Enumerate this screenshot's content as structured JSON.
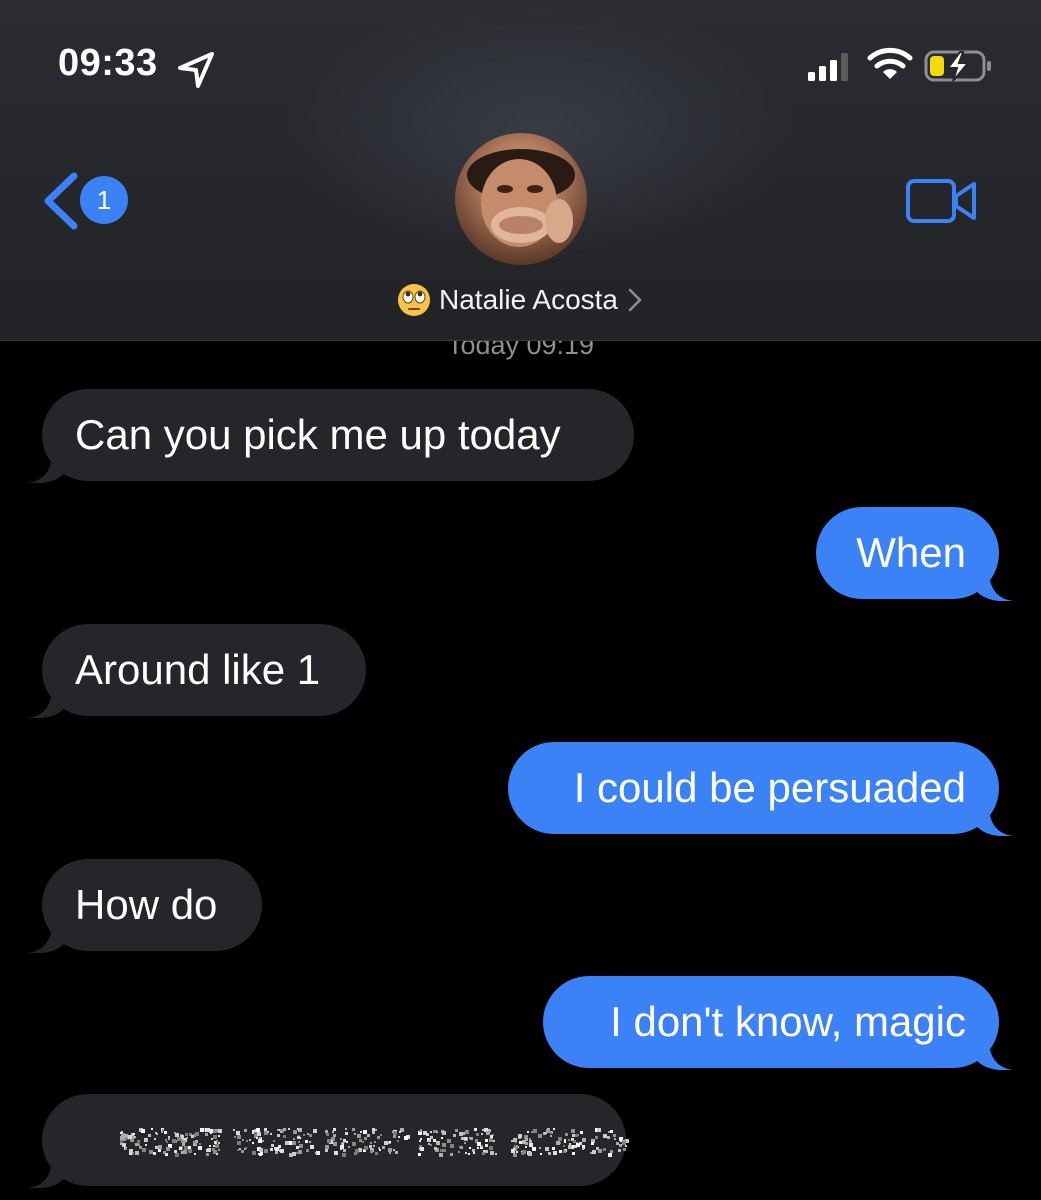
{
  "status_bar": {
    "time": "09:33"
  },
  "header": {
    "back_badge_count": "1",
    "contact_emoji": "🙄",
    "contact_name": "Natalie Acosta"
  },
  "conversation": {
    "timestamp": "Today 09:19",
    "messages": [
      {
        "direction": "incoming",
        "text": "Can you pick me up today"
      },
      {
        "direction": "outgoing",
        "text": "When"
      },
      {
        "direction": "incoming",
        "text": "Around like 1"
      },
      {
        "direction": "outgoing",
        "text": "I could be persuaded"
      },
      {
        "direction": "incoming",
        "text": "How do"
      },
      {
        "direction": "outgoing",
        "text": "I don't know, magic"
      },
      {
        "direction": "incoming",
        "text": "",
        "redacted": true
      }
    ]
  },
  "colors": {
    "outgoing_bubble": "#3b82f6",
    "incoming_bubble": "#26252a",
    "accent": "#3b82f6"
  }
}
